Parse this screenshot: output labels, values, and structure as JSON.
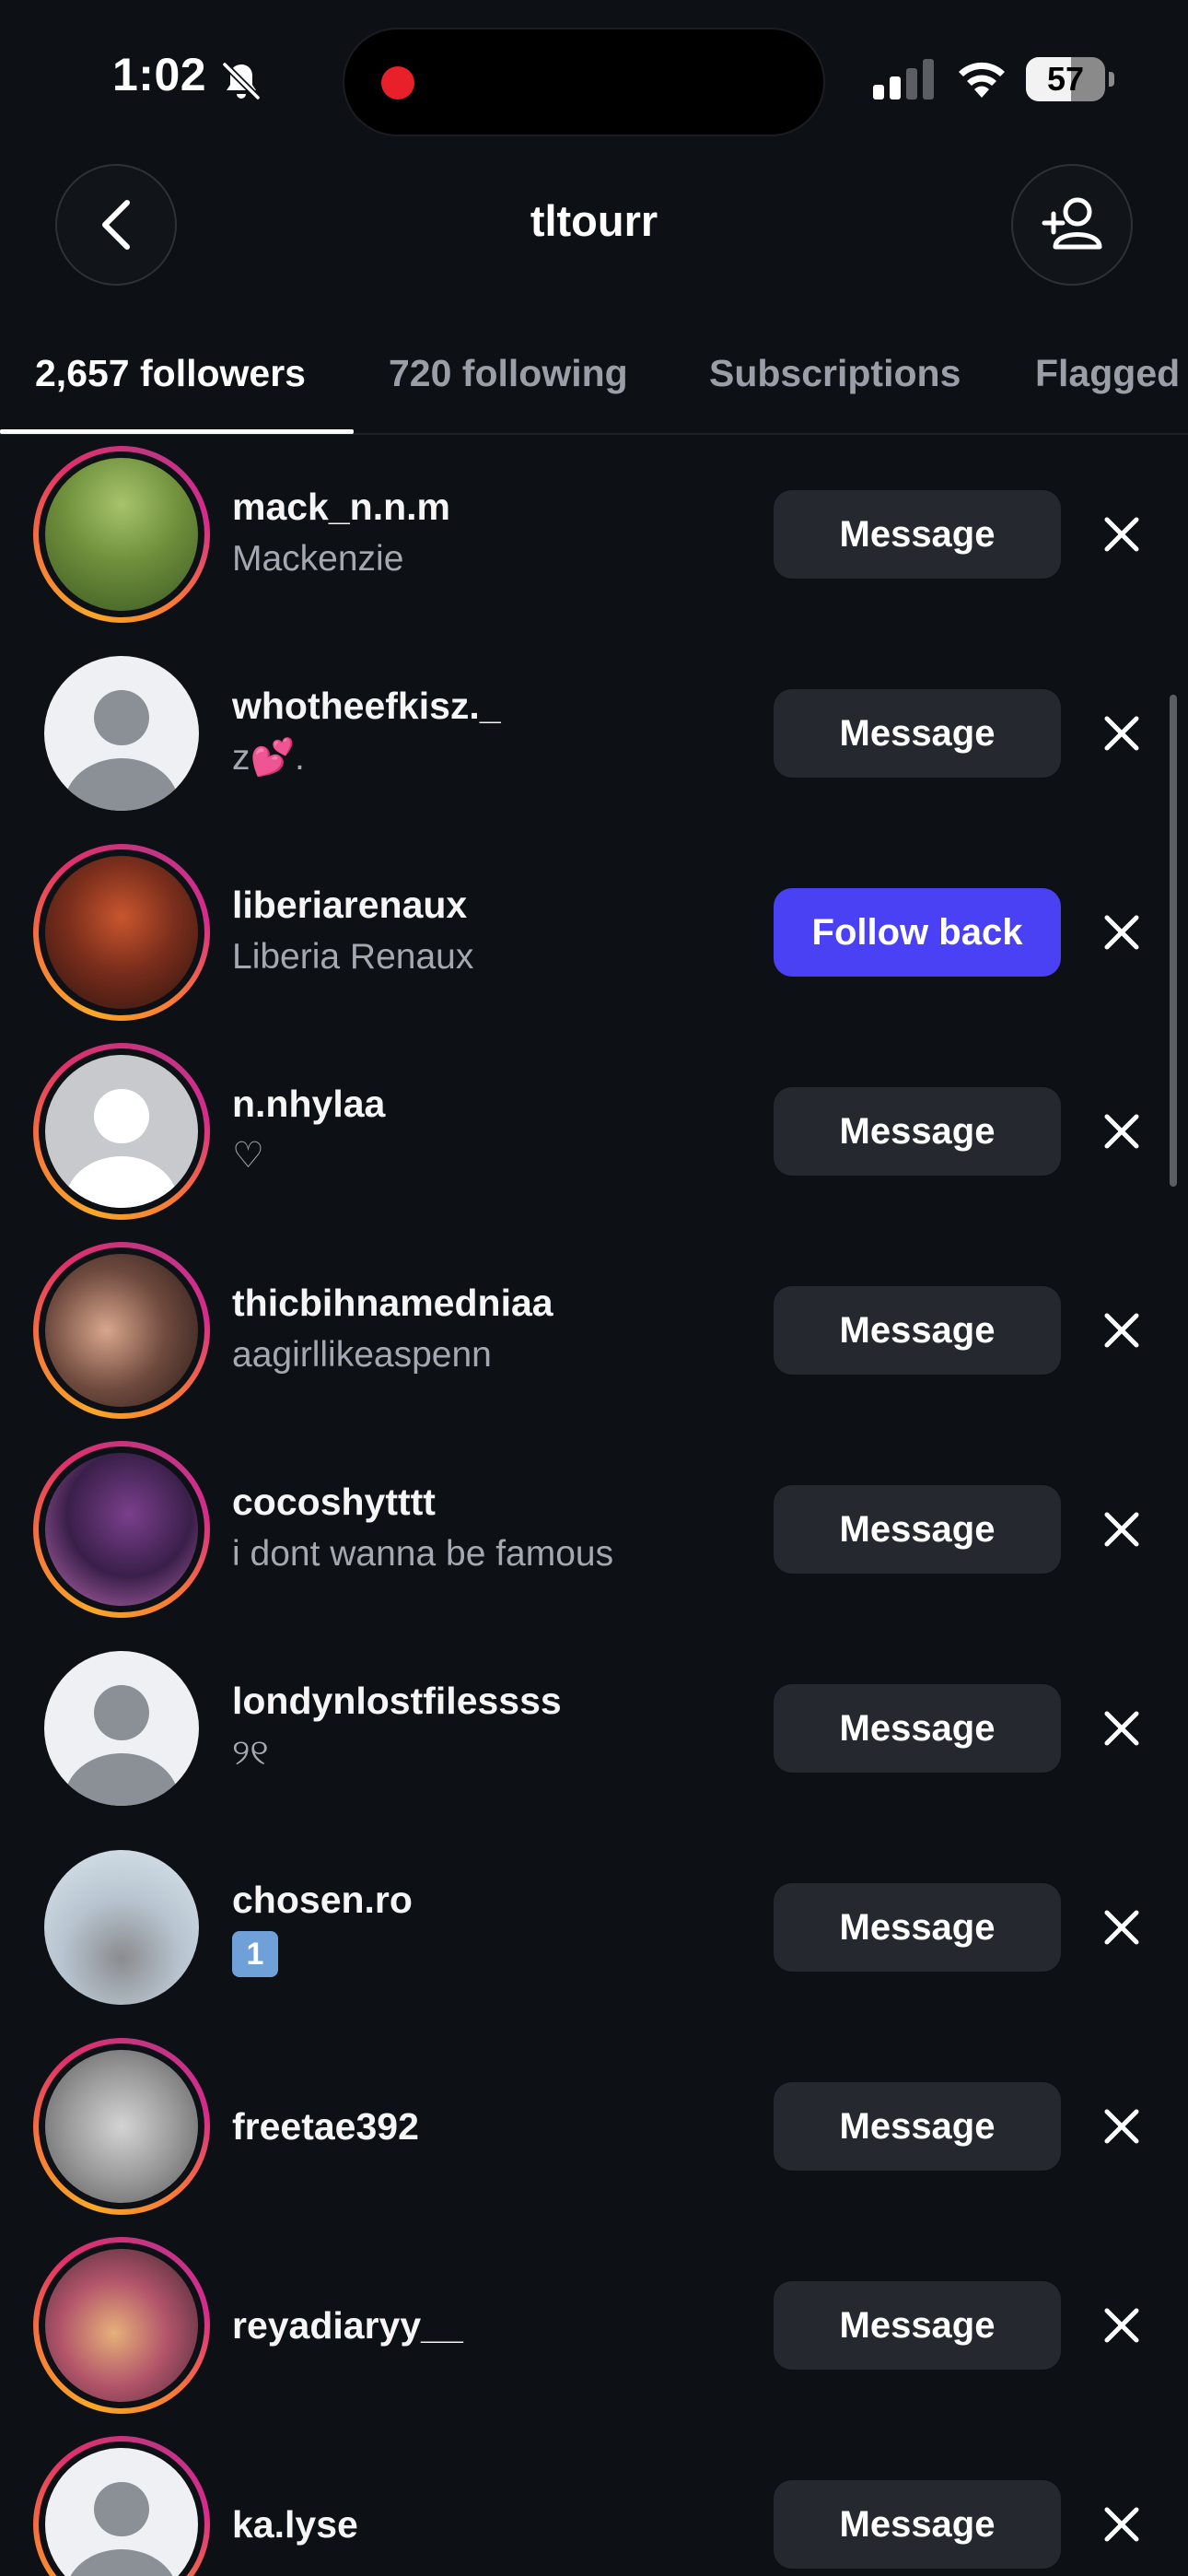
{
  "status_bar": {
    "time": "1:02",
    "battery": "57",
    "battery_level": 0.57,
    "icons": [
      "bell-slash-icon",
      "signal-icon",
      "wifi-icon",
      "battery-icon"
    ]
  },
  "header": {
    "title": "tltourr",
    "back_icon": "chevron-left-icon",
    "add_icon": "add-person-icon"
  },
  "tabs": [
    {
      "label": "2,657 followers",
      "active": true
    },
    {
      "label": "720 following",
      "active": false
    },
    {
      "label": "Subscriptions",
      "active": false
    },
    {
      "label": "Flagged",
      "active": false
    }
  ],
  "followers": [
    {
      "username": "mack_n.n.m",
      "subtitle": "Mackenzie",
      "action": "Message",
      "ring": true,
      "avatar": "photo"
    },
    {
      "username": "whotheefkisz._",
      "subtitle": "z💕.",
      "action": "Message",
      "ring": false,
      "avatar": "default"
    },
    {
      "username": "liberiarenaux",
      "subtitle": "Liberia Renaux",
      "action": "Follow back",
      "ring": true,
      "avatar": "photo"
    },
    {
      "username": "n.nhylaa",
      "subtitle": "♡",
      "action": "Message",
      "ring": true,
      "avatar": "default-light"
    },
    {
      "username": "thicbihnamedniaa",
      "subtitle": "aagirllikeaspenn",
      "action": "Message",
      "ring": true,
      "avatar": "photo"
    },
    {
      "username": "cocoshytttt",
      "subtitle": "i dont wanna be famous",
      "action": "Message",
      "ring": true,
      "avatar": "photo"
    },
    {
      "username": "londynlostfilessss",
      "subtitle": "୨୧",
      "action": "Message",
      "ring": false,
      "avatar": "default"
    },
    {
      "username": "chosen.ro",
      "subtitle": "1",
      "action": "Message",
      "ring": false,
      "avatar": "photo"
    },
    {
      "username": "freetae392",
      "subtitle": "",
      "action": "Message",
      "ring": true,
      "avatar": "photo"
    },
    {
      "username": "reyadiaryy__",
      "subtitle": "",
      "action": "Message",
      "ring": true,
      "avatar": "photo"
    },
    {
      "username": "ka.lyse",
      "subtitle": "",
      "action": "Message",
      "ring": true,
      "avatar": "default"
    }
  ],
  "colors": {
    "background": "#0d1015",
    "button": "#25282e",
    "primary_button": "#4a41f5",
    "secondary_text": "#a4a8b0"
  }
}
